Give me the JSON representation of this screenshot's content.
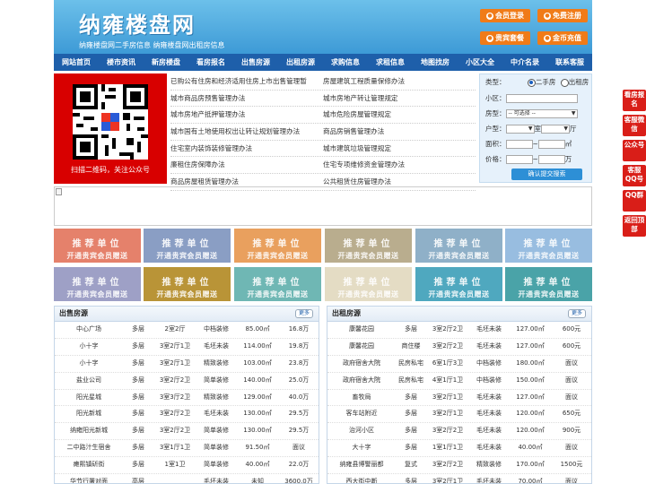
{
  "header": {
    "logo": "纳雍楼盘网",
    "subtitle": "纳雍楼盘网二手房信息    纳雍楼盘网出租房信息",
    "buttons": [
      {
        "label": "会员登录",
        "icon": "user-icon"
      },
      {
        "label": "免费注册",
        "icon": "register-icon"
      },
      {
        "label": "贵宾套餐",
        "icon": "vip-icon"
      },
      {
        "label": "金币充值",
        "icon": "coin-icon"
      }
    ]
  },
  "nav": [
    "网站首页",
    "楼市资讯",
    "新房楼盘",
    "看房报名",
    "出售房源",
    "出租房源",
    "求购信息",
    "求租信息",
    "地图找房",
    "小区大全",
    "中介名录",
    "联系客服"
  ],
  "qr": {
    "caption": "扫描二维码，关注公众号"
  },
  "news_links": [
    [
      "已购公有住房和经济适用住房上市出售管理暂",
      "房屋建筑工程质量保修办法"
    ],
    [
      "城市商品房预售管理办法",
      "城市房地产转让管理规定"
    ],
    [
      "城市房地产抵押管理办法",
      "城市危险房屋管理规定"
    ],
    [
      "城市国有土地使用权出让转让规划管理办法",
      "商品房销售管理办法"
    ],
    [
      "住宅室内装饰装修管理办法",
      "城市建筑垃圾管理规定"
    ],
    [
      "廉租住房保障办法",
      "住宅专项维修资金管理办法"
    ],
    [
      "商品房屋租赁管理办法",
      "公共租赁住房管理办法"
    ]
  ],
  "search": {
    "type_label": "类型：",
    "type_options": [
      "二手房",
      "出租房"
    ],
    "type_selected": "二手房",
    "community_label": "小区：",
    "housetype_label": "房型：",
    "housetype_value": "-- 可选择 --",
    "layout_label": "户型：",
    "room_unit": "室",
    "hall_unit": "厅",
    "area_label": "面积：",
    "area_unit": "㎡",
    "price_label": "价格：",
    "price_unit": "万",
    "range_sep": "~",
    "submit": "确认提交搜索"
  },
  "promo": {
    "line1": "推荐单位",
    "line2": "开通贵宾会员赠送",
    "colors": [
      "#e5816b",
      "#8a9ec4",
      "#e9a05e",
      "#b9ad8e",
      "#8fb0c8",
      "#98bde0",
      "#9ea0c6",
      "#b99437",
      "#6fb7b4",
      "#e4dcc4",
      "#4fa8bf",
      "#4aa3a8"
    ]
  },
  "sale": {
    "title": "出售房源",
    "more": "更多",
    "rows": [
      [
        "中心广场",
        "多层",
        "2室2厅",
        "中档装修",
        "85.00㎡",
        "16.8万"
      ],
      [
        "小十字",
        "多层",
        "3室2厅1卫",
        "毛坯未装",
        "114.00㎡",
        "19.8万"
      ],
      [
        "小十字",
        "多层",
        "3室2厅1卫",
        "精致装修",
        "103.00㎡",
        "23.8万"
      ],
      [
        "盐业公司",
        "多层",
        "3室2厅2卫",
        "简单装修",
        "140.00㎡",
        "25.0万"
      ],
      [
        "阳光星城",
        "多层",
        "3室3厅2卫",
        "精致装修",
        "129.00㎡",
        "40.0万"
      ],
      [
        "阳光新城",
        "多层",
        "3室2厅2卫",
        "毛坯未装",
        "130.00㎡",
        "29.5万"
      ],
      [
        "纳雍阳光新城",
        "多层",
        "3室2厅2卫",
        "简单装修",
        "130.00㎡",
        "29.5万"
      ],
      [
        "二中路汁生宿舍",
        "多层",
        "3室1厅1卫",
        "简单装修",
        "91.50㎡",
        "面议"
      ],
      [
        "瘫熙镇斫街",
        "多层",
        "1室1卫",
        "简单装修",
        "40.00㎡",
        "22.0万"
      ],
      [
        "华节行署对面",
        "高层",
        "",
        "毛坯未装",
        "未知",
        "3600.0万"
      ]
    ]
  },
  "rent": {
    "title": "出租房源",
    "more": "更多",
    "rows": [
      [
        "康馨花园",
        "多层",
        "3室2厅2卫",
        "毛坯未装",
        "127.00㎡",
        "600元"
      ],
      [
        "康馨花园",
        "商住楼",
        "3室2厅2卫",
        "毛坯未装",
        "127.00㎡",
        "600元"
      ],
      [
        "政府宿舍大院",
        "民房私宅",
        "6室1厅3卫",
        "中档装修",
        "180.00㎡",
        "面议"
      ],
      [
        "政府宿舍大院",
        "民房私宅",
        "4室1厅1卫",
        "中档装修",
        "150.00㎡",
        "面议"
      ],
      [
        "畜牧局",
        "多层",
        "3室2厅1卫",
        "毛坯未装",
        "127.00㎡",
        "面议"
      ],
      [
        "客车站附近",
        "多层",
        "3室2厅1卫",
        "毛坯未装",
        "120.00㎡",
        "650元"
      ],
      [
        "治河小区",
        "多层",
        "3室2厅2卫",
        "毛坯未装",
        "120.00㎡",
        "900元"
      ],
      [
        "大十字",
        "多层",
        "1室1厅1卫",
        "毛坯未装",
        "40.00㎡",
        "面议"
      ],
      [
        "纳雍县博警丽都",
        "复式",
        "3室2厅2卫",
        "精致装修",
        "170.00㎡",
        "1500元"
      ],
      [
        "西大街中断",
        "多层",
        "3室2厅1卫",
        "毛坯未装",
        "70.00㎡",
        "面议"
      ]
    ]
  },
  "sidebar": [
    "看房报名",
    "客服微信",
    "公众号",
    "客服QQ号",
    "QQ群",
    "返回顶部"
  ]
}
